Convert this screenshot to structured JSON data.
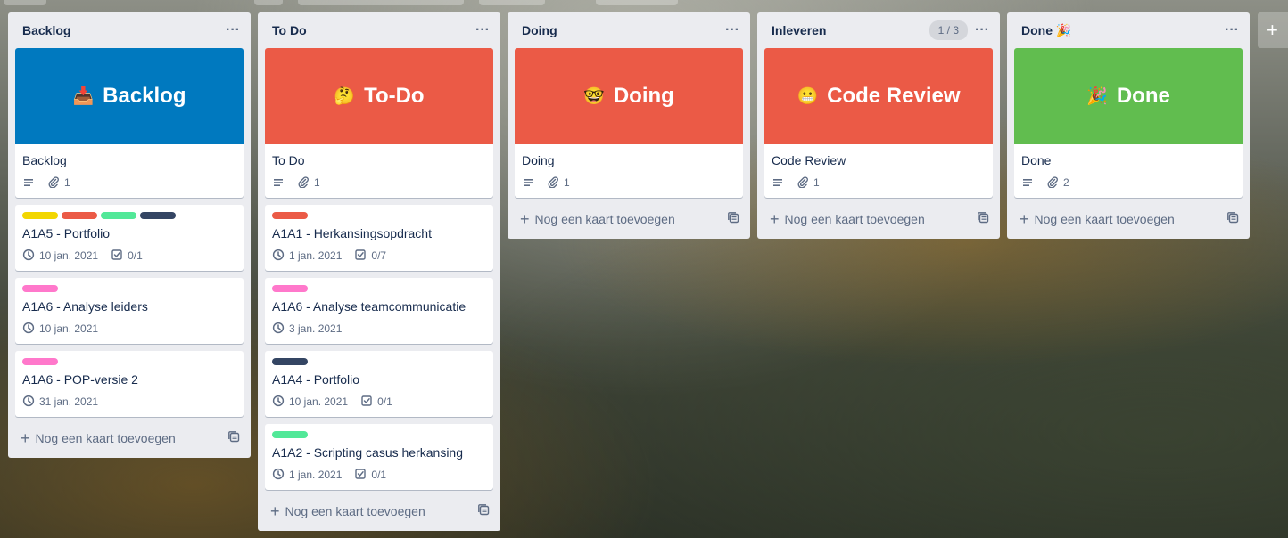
{
  "lists": [
    {
      "title": "Backlog",
      "count": "",
      "cover": {
        "emoji": "📥",
        "text": "Backlog",
        "color": "#0079bf"
      },
      "cover_card": {
        "title": "Backlog",
        "attachments": "1"
      },
      "cards": [
        {
          "title": "A1A5 - Portfolio",
          "labels": [
            "#f2d600",
            "#eb5a46",
            "#51e898",
            "#344563"
          ],
          "date": "10 jan. 2021",
          "checklist": "0/1"
        },
        {
          "title": "A1A6 - Analyse leiders",
          "labels": [
            "#ff78cb"
          ],
          "date": "10 jan. 2021",
          "checklist": ""
        },
        {
          "title": "A1A6 - POP-versie 2",
          "labels": [
            "#ff78cb"
          ],
          "date": "31 jan. 2021",
          "checklist": ""
        }
      ],
      "add_label": "Nog een kaart toevoegen"
    },
    {
      "title": "To Do",
      "count": "",
      "cover": {
        "emoji": "🤔",
        "text": "To-Do",
        "color": "#eb5a46"
      },
      "cover_card": {
        "title": "To Do",
        "attachments": "1"
      },
      "cards": [
        {
          "title": "A1A1 - Herkansingsopdracht",
          "labels": [
            "#eb5a46"
          ],
          "date": "1 jan. 2021",
          "checklist": "0/7"
        },
        {
          "title": "A1A6 - Analyse teamcommunicatie",
          "labels": [
            "#ff78cb"
          ],
          "date": "3 jan. 2021",
          "checklist": ""
        },
        {
          "title": "A1A4 - Portfolio",
          "labels": [
            "#344563"
          ],
          "date": "10 jan. 2021",
          "checklist": "0/1"
        },
        {
          "title": "A1A2 - Scripting casus herkansing",
          "labels": [
            "#51e898"
          ],
          "date": "1 jan. 2021",
          "checklist": "0/1"
        }
      ],
      "add_label": "Nog een kaart toevoegen"
    },
    {
      "title": "Doing",
      "count": "",
      "cover": {
        "emoji": "🤓",
        "text": "Doing",
        "color": "#eb5a46"
      },
      "cover_card": {
        "title": "Doing",
        "attachments": "1"
      },
      "cards": [],
      "add_label": "Nog een kaart toevoegen"
    },
    {
      "title": "Inleveren",
      "count": "1 / 3",
      "cover": {
        "emoji": "😬",
        "text": "Code Review",
        "color": "#eb5a46"
      },
      "cover_card": {
        "title": "Code Review",
        "attachments": "1"
      },
      "cards": [],
      "add_label": "Nog een kaart toevoegen"
    },
    {
      "title": "Done 🎉",
      "count": "",
      "cover": {
        "emoji": "🎉",
        "text": "Done",
        "color": "#61bd4f"
      },
      "cover_card": {
        "title": "Done",
        "attachments": "2"
      },
      "cards": [],
      "add_label": "Nog een kaart toevoegen"
    }
  ],
  "add_list_symbol": "+"
}
